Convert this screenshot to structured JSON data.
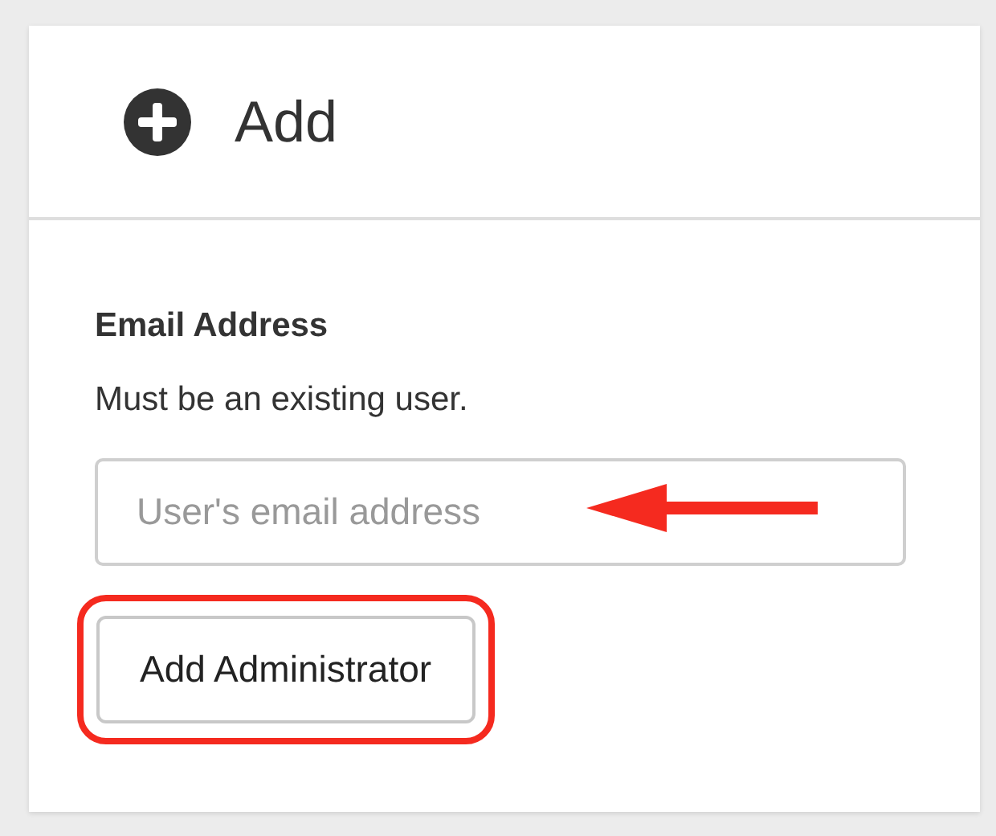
{
  "panel": {
    "title": "Add"
  },
  "field": {
    "label": "Email Address",
    "help": "Must be an existing user.",
    "placeholder": "User's email address"
  },
  "button": {
    "label": "Add Administrator"
  }
}
